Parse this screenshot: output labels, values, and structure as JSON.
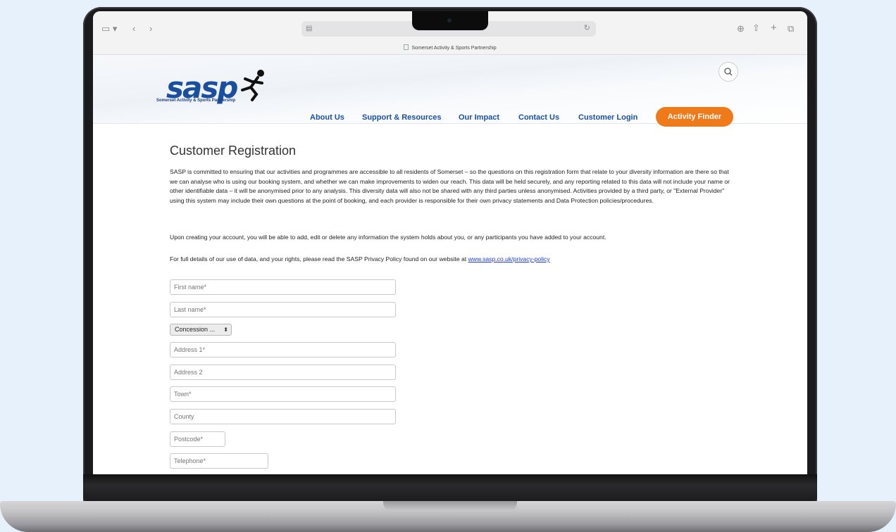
{
  "browser": {
    "tab_title": "Somerset Activity & Sports Partnership"
  },
  "site": {
    "logo": "sasp",
    "logo_subtitle": "Somerset Activity & Sports Partnership",
    "nav": [
      "About Us",
      "Support & Resources",
      "Our Impact",
      "Contact Us",
      "Customer Login"
    ],
    "cta": "Activity Finder"
  },
  "page": {
    "title": "Customer Registration",
    "paragraphs": [
      "SASP is committed to ensuring that our activities and programmes are accessible to all residents of Somerset – so the questions on this registration form that relate to your diversity information are there so that we can analyse who is using our booking system, and whether we can make improvements to widen our reach. This data will be held securely, and any reporting related to this data will not include your name or other identifiable data – it will be anonymised prior to any analysis. This diversity data will also not be shared with any third parties unless anonymised. Activities provided by a third party, or \"External Provider\" using this system may include their own questions at the point of booking, and each provider is responsible for their own privacy statements and Data Protection policies/procedures.",
      "Upon creating your account, you will be able to add, edit or delete any information the system holds about you, or any participants you have added to your account."
    ],
    "privacy_prefix": "For full details of our use of data, and your rights, please read the SASP Privacy Policy found on our website at ",
    "privacy_link": "www.sasp.co.uk/privacy-policy"
  },
  "form": {
    "first_name": "First name*",
    "last_name": "Last name*",
    "concession": "Concession ...",
    "address1": "Address 1*",
    "address2": "Address 2",
    "town": "Town*",
    "county": "County",
    "postcode": "Postcode*",
    "telephone": "Telephone*"
  },
  "colors": {
    "brand_blue": "#1a4fa0",
    "cta_orange": "#ef7a1a",
    "page_background": "#e6f1fc"
  }
}
